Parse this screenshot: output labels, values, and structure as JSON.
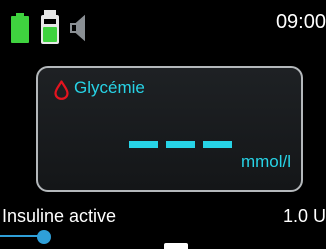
{
  "status": {
    "time": "09:00",
    "battery_icon": "battery-full-icon",
    "cartridge_icon": "cartridge-icon",
    "sound_icon": "speaker-icon",
    "colors": {
      "battery": "#3fd33f",
      "cartridge": "#3fd33f",
      "speaker": "#8a8f94"
    }
  },
  "glucose": {
    "title": "Glycémie",
    "value": "---",
    "unit": "mmol/l",
    "icon": "blood-drop-icon",
    "colors": {
      "accent": "#27d3e6",
      "drop": "#e4141f"
    }
  },
  "active_insulin": {
    "label": "Insuline active",
    "value": "1.0 U"
  },
  "progress": {
    "level": 0.14,
    "color": "#2f9fd8"
  }
}
